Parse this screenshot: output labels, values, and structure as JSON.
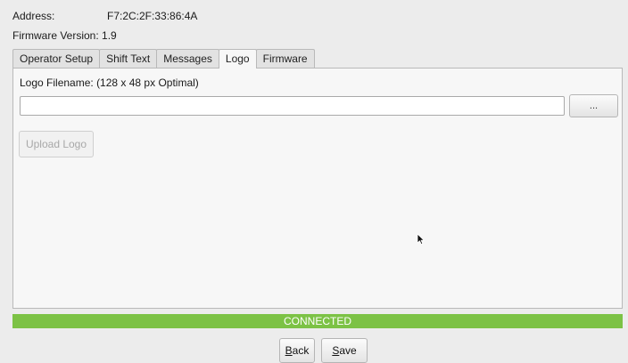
{
  "device": {
    "address_label": "Address:",
    "address_value": "F7:2C:2F:33:86:4A",
    "firmware_label": "Firmware Version:",
    "firmware_value": "1.9"
  },
  "tabs": [
    {
      "label": "Operator Setup",
      "active": false
    },
    {
      "label": "Shift Text",
      "active": false
    },
    {
      "label": "Messages",
      "active": false
    },
    {
      "label": "Logo",
      "active": true
    },
    {
      "label": "Firmware",
      "active": false
    }
  ],
  "logo_panel": {
    "filename_label": "Logo Filename:",
    "filename_hint": "(128 x 48 px Optimal)",
    "filename_value": "",
    "browse_label": "...",
    "upload_label": "Upload Logo",
    "upload_enabled": false
  },
  "status": {
    "text": "CONNECTED",
    "color": "#7cc245"
  },
  "actions": {
    "back_mnemonic": "B",
    "back_rest": "ack",
    "save_mnemonic": "S",
    "save_rest": "ave"
  },
  "cursor_icon": "arrow-pointer-icon"
}
